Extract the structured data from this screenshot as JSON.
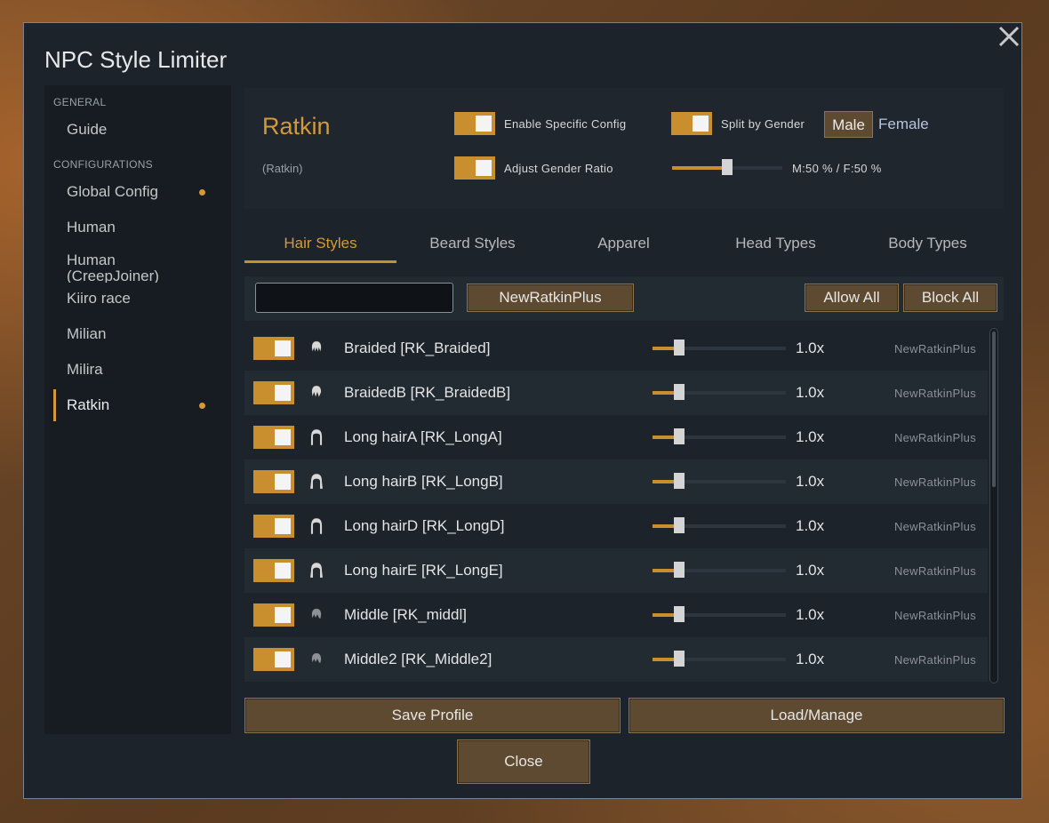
{
  "dialog": {
    "title": "NPC Style Limiter"
  },
  "sidebar": {
    "general_header": "GENERAL",
    "general_items": [
      {
        "label": "Guide"
      }
    ],
    "config_header": "CONFIGURATIONS",
    "config_items": [
      {
        "label": "Global Config",
        "modified": true
      },
      {
        "label": "Human",
        "modified": false
      },
      {
        "label": "Human (CreepJoiner)",
        "modified": false
      },
      {
        "label": "Kiiro race",
        "modified": false
      },
      {
        "label": "Milian",
        "modified": false
      },
      {
        "label": "Milira",
        "modified": false
      },
      {
        "label": "Ratkin",
        "modified": true,
        "selected": true
      }
    ]
  },
  "race": {
    "name": "Ratkin",
    "def_name": "(Ratkin)",
    "enable_specific_label": "Enable Specific Config",
    "enable_specific_on": true,
    "split_gender_label": "Split by Gender",
    "split_gender_on": true,
    "adjust_ratio_label": "Adjust Gender Ratio",
    "adjust_ratio_on": true,
    "gender_male": "Male",
    "gender_female": "Female",
    "gender_selected": "Male",
    "ratio_value": 0.5,
    "ratio_text": "M:50 % / F:50 %"
  },
  "tabs": [
    {
      "label": "Hair Styles",
      "active": true
    },
    {
      "label": "Beard Styles",
      "active": false
    },
    {
      "label": "Apparel",
      "active": false
    },
    {
      "label": "Head Types",
      "active": false
    },
    {
      "label": "Body Types",
      "active": false
    }
  ],
  "toolbar": {
    "search_value": "",
    "mod_filter_label": "NewRatkinPlus",
    "allow_all_label": "Allow All",
    "block_all_label": "Block All"
  },
  "hair_styles": [
    {
      "name": "Braided [RK_Braided]",
      "weight": "1.0x",
      "source": "NewRatkinPlus",
      "enabled": true,
      "weight_value": 1.0
    },
    {
      "name": "BraidedB [RK_BraidedB]",
      "weight": "1.0x",
      "source": "NewRatkinPlus",
      "enabled": true,
      "weight_value": 1.0
    },
    {
      "name": "Long hairA [RK_LongA]",
      "weight": "1.0x",
      "source": "NewRatkinPlus",
      "enabled": true,
      "weight_value": 1.0
    },
    {
      "name": "Long hairB [RK_LongB]",
      "weight": "1.0x",
      "source": "NewRatkinPlus",
      "enabled": true,
      "weight_value": 1.0
    },
    {
      "name": "Long hairD [RK_LongD]",
      "weight": "1.0x",
      "source": "NewRatkinPlus",
      "enabled": true,
      "weight_value": 1.0
    },
    {
      "name": "Long hairE [RK_LongE]",
      "weight": "1.0x",
      "source": "NewRatkinPlus",
      "enabled": true,
      "weight_value": 1.0
    },
    {
      "name": "Middle [RK_middl]",
      "weight": "1.0x",
      "source": "NewRatkinPlus",
      "enabled": true,
      "weight_value": 1.0
    },
    {
      "name": "Middle2 [RK_Middle2]",
      "weight": "1.0x",
      "source": "NewRatkinPlus",
      "enabled": true,
      "weight_value": 1.0
    }
  ],
  "footer": {
    "save_profile_label": "Save Profile",
    "load_manage_label": "Load/Manage",
    "close_label": "Close"
  },
  "colors": {
    "accent": "#d49a3a",
    "toggle_on": "#c98f2e",
    "button_bg": "#5e4a30",
    "panel_bg": "#1c232b"
  },
  "icons": {
    "close": "close-x-icon",
    "hair": "hair-style-icon"
  }
}
